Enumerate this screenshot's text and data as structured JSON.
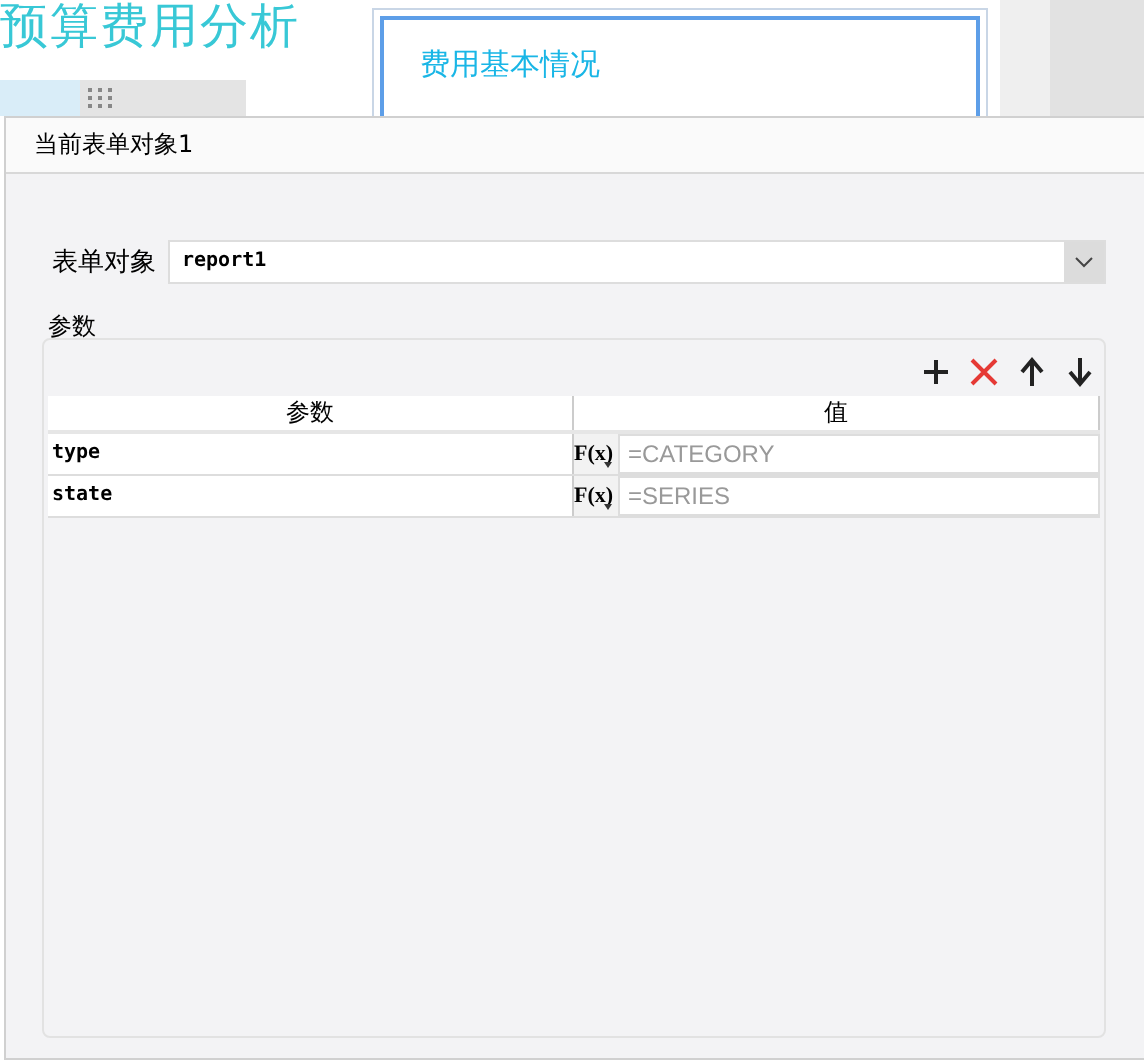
{
  "background": {
    "report_title": "预算费用分析",
    "widget_title": "费用基本情况"
  },
  "dialog": {
    "title": "当前表单对象1",
    "form_object": {
      "label": "表单对象",
      "value": "report1"
    },
    "params": {
      "legend": "参数",
      "columns": [
        "参数",
        "值"
      ],
      "rows": [
        {
          "name": "type",
          "formula": "F(x)",
          "value": "=CATEGORY"
        },
        {
          "name": "state",
          "formula": "F(x)",
          "value": "=SERIES"
        }
      ]
    }
  }
}
